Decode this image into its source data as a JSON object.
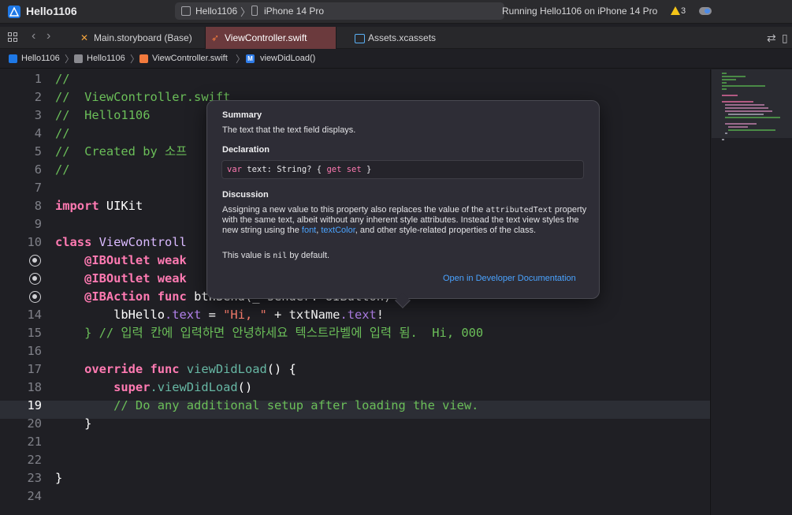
{
  "toolbar": {
    "project_title": "Hello1106",
    "scheme": "Hello1106",
    "device": "iPhone 14 Pro",
    "run_status": "Running Hello1106 on iPhone 14 Pro",
    "warning_count": "3"
  },
  "tabs": [
    {
      "label": "Main.storyboard (Base)",
      "icon": "storyboard-icon",
      "active": false
    },
    {
      "label": "ViewController.swift",
      "icon": "swift-icon",
      "active": true
    },
    {
      "label": "Assets.xcassets",
      "icon": "assets-icon",
      "active": false
    }
  ],
  "breadcrumb": [
    "Hello1106",
    "Hello1106",
    "ViewController.swift",
    "viewDidLoad()"
  ],
  "editor": {
    "current_line": 19,
    "lines": [
      {
        "n": "1",
        "text": "//"
      },
      {
        "n": "2",
        "text": "//  ViewController.swift"
      },
      {
        "n": "3",
        "text": "//  Hello1106"
      },
      {
        "n": "4",
        "text": "//"
      },
      {
        "n": "5",
        "text": "//  Created by 소프"
      },
      {
        "n": "6",
        "text": "//"
      },
      {
        "n": "7",
        "text": ""
      },
      {
        "n": "8",
        "kw": "import",
        "rest": " UIKit"
      },
      {
        "n": "9",
        "text": ""
      },
      {
        "n": "10",
        "kw": "class",
        "rest": " ViewControll"
      },
      {
        "n": "",
        "attr": "    @IBOutlet",
        "kw2": " weak"
      },
      {
        "n": "",
        "attr": "    @IBOutlet",
        "kw2": " weak"
      },
      {
        "n": "",
        "attr": "    @IBAction",
        "kw2": " func",
        "rest": " btnSend(_ sender: UIButton) {"
      },
      {
        "n": "14",
        "a": "        lbHello",
        "b": ".text",
        "c": " = ",
        "s": "\"Hi, \"",
        "d": " + txtName",
        "e": ".text",
        "f": "!"
      },
      {
        "n": "15",
        "text": "    } // 입력 칸에 입력하면 안녕하세요 텍스트라벨에 입력 됨.  Hi, 000"
      },
      {
        "n": "16",
        "text": ""
      },
      {
        "n": "17",
        "kw": "    override",
        "kw2": " func",
        "fn": " viewDidLoad",
        "rest": "() {"
      },
      {
        "n": "18",
        "kw": "        super",
        "fn": ".viewDidLoad",
        "rest": "()"
      },
      {
        "n": "19",
        "text": "        // Do any additional setup after loading the view."
      },
      {
        "n": "20",
        "text": "    }"
      },
      {
        "n": "21",
        "text": ""
      },
      {
        "n": "22",
        "text": ""
      },
      {
        "n": "23",
        "text": "}"
      },
      {
        "n": "24",
        "text": ""
      }
    ]
  },
  "popover": {
    "summary_heading": "Summary",
    "summary_text": "The text that the text field displays.",
    "declaration_heading": "Declaration",
    "declaration": {
      "kw1": "var",
      "mid": " text: String? { ",
      "kw2": "get",
      "sp": " ",
      "kw3": "set",
      "end": " }"
    },
    "discussion_heading": "Discussion",
    "discussion": {
      "p1": "Assigning a new value to this property also replaces the value of the ",
      "p1_code": "attributedText",
      "p2": " property with the same text, albeit without any inherent style attributes. Instead the text view styles the new string using the ",
      "link1": "font",
      "p3": ", ",
      "link2": "textColor",
      "p4": ", and other style-related properties of the class."
    },
    "nil_text_1": "This value is ",
    "nil_code": "nil",
    "nil_text_2": " by default.",
    "doc_link": "Open in Developer Documentation"
  },
  "colors": {
    "active_tab": "#6b3a3d",
    "comment": "#6bbf59",
    "keyword": "#ff7ab2",
    "link": "#4aa3ff",
    "warning": "#f5c518"
  }
}
